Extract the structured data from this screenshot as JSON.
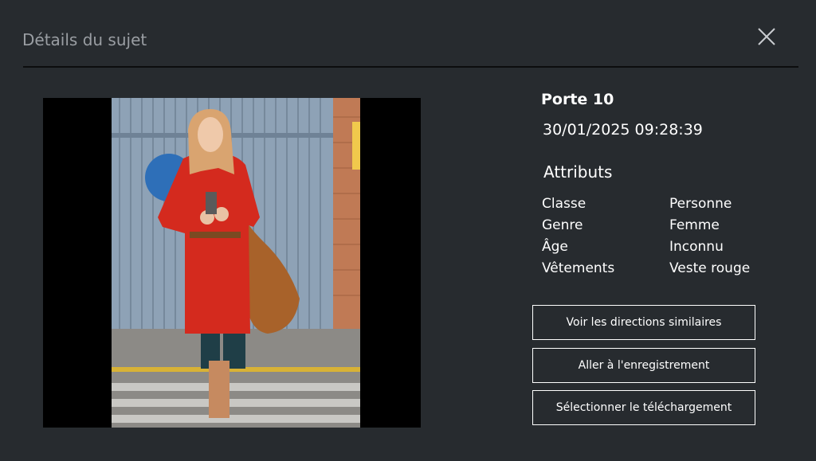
{
  "header": {
    "title": "Détails du sujet",
    "close_icon": "close-icon"
  },
  "subject": {
    "location": "Porte 10",
    "datetime": "30/01/2025 09:28:39",
    "attributes_heading": "Attributs",
    "attributes": [
      {
        "key": "Classe",
        "value": "Personne"
      },
      {
        "key": "Genre",
        "value": "Femme"
      },
      {
        "key": "Âge",
        "value": "Inconnu"
      },
      {
        "key": "Vêtements",
        "value": "Veste rouge"
      }
    ]
  },
  "actions": {
    "similar_directions": "Voir les directions similaires",
    "go_to_recording": "Aller à l'enregistrement",
    "select_download": "Sélectionner le téléchargement"
  },
  "colors": {
    "background": "#272b2f",
    "header_text": "#9a9ea3",
    "text": "#ffffff",
    "divider": "#0c0d0e"
  }
}
